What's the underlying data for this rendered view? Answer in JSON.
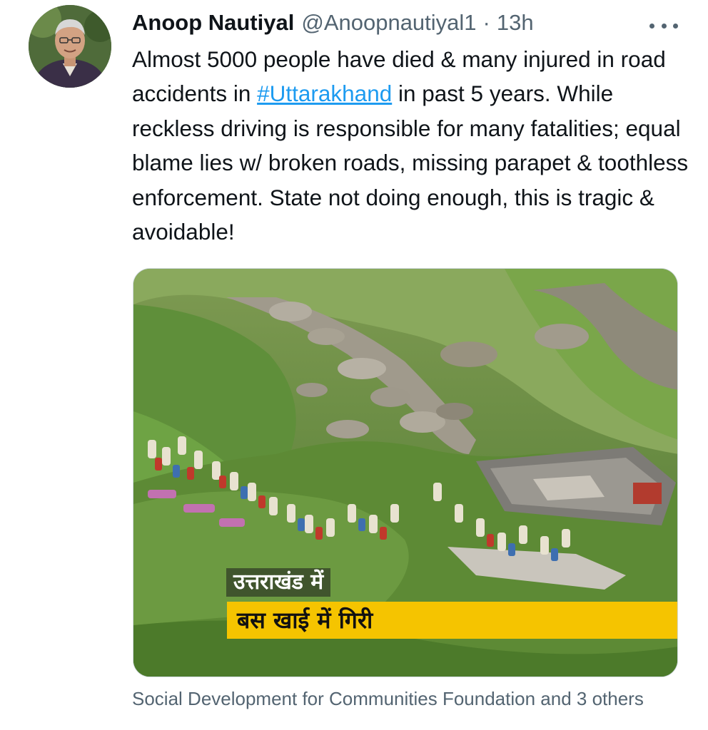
{
  "tweet": {
    "author": {
      "display_name": "Anoop Nautiyal",
      "handle": "@Anoopnautiyal1",
      "separator": "·",
      "time": "13h"
    },
    "text": {
      "before_hashtag": "Almost 5000 people have died & many injured in road accidents in ",
      "hashtag": "#Uttarakhand",
      "after_hashtag": " in past 5 years. While reckless driving is responsible for many fatalities; equal blame lies w/ broken roads, missing parapet & toothless enforcement. State not doing enough, this is tragic & avoidable!"
    },
    "media": {
      "caption_line1": "उत्तराखंड में",
      "caption_line2": "बस खाई में गिरी"
    },
    "tagged_people": "Social Development for Communities Foundation and 3 others",
    "icons": {
      "more": "more-horizontal-icon"
    },
    "colors": {
      "link": "#1d9bf0",
      "secondary_text": "#536471",
      "caption_band": "#f5c400"
    }
  }
}
